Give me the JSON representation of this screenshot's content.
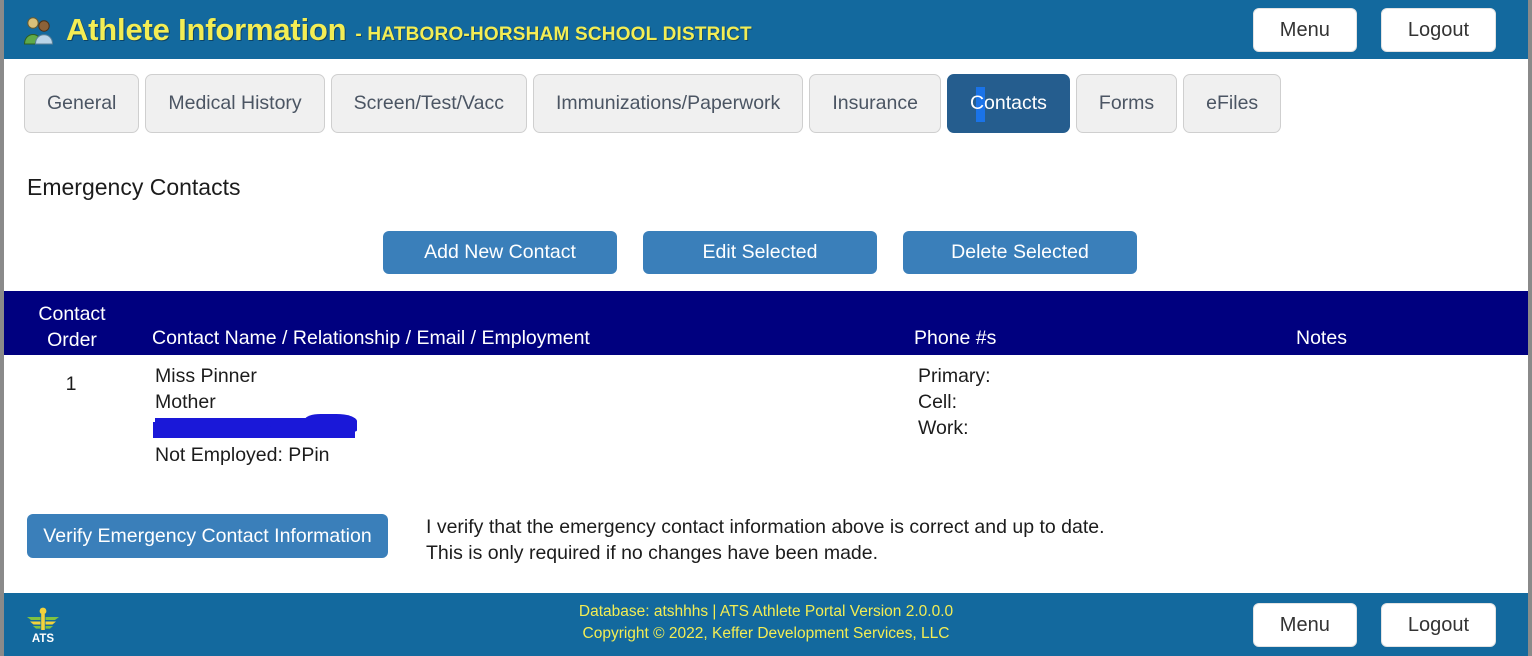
{
  "header": {
    "icon": "people-icon",
    "title": "Athlete Information",
    "subtitle": "- HATBORO-HORSHAM SCHOOL DISTRICT",
    "menu_label": "Menu",
    "logout_label": "Logout",
    "bg_color": "#13699e",
    "title_color": "#f3ed54"
  },
  "tabs": [
    {
      "label": "General",
      "active": false
    },
    {
      "label": "Medical History",
      "active": false
    },
    {
      "label": "Screen/Test/Vacc",
      "active": false
    },
    {
      "label": "Immunizations/Paperwork",
      "active": false
    },
    {
      "label": "Insurance",
      "active": false
    },
    {
      "label": "Contacts",
      "active": true
    },
    {
      "label": "Forms",
      "active": false
    },
    {
      "label": "eFiles",
      "active": false
    }
  ],
  "main": {
    "section_title": "Emergency Contacts",
    "actions": [
      {
        "label": "Add New Contact",
        "name": "add-new-contact-button"
      },
      {
        "label": "Edit Selected",
        "name": "edit-selected-button"
      },
      {
        "label": "Delete Selected",
        "name": "delete-selected-button"
      }
    ],
    "table": {
      "header_bg": "#00007f",
      "columns": {
        "order_line1": "Contact",
        "order_line2": "Order",
        "name": "Contact Name / Relationship / Email / Employment",
        "phone": "Phone #s",
        "notes": "Notes"
      },
      "rows": [
        {
          "order": "1",
          "name": "Miss Pinner",
          "relationship": "Mother",
          "email": "",
          "email_redacted": true,
          "redaction_color": "#1a18d8",
          "employment": "Not Employed: PPin",
          "phones": [
            {
              "label": "Primary:",
              "value": ""
            },
            {
              "label": "Cell:",
              "value": ""
            },
            {
              "label": "Work:",
              "value": ""
            }
          ],
          "notes": ""
        }
      ]
    },
    "verify": {
      "button_label": "Verify Emergency Contact Information",
      "line1": "I verify that the emergency contact information above is correct and up to date.",
      "line2": "This is only required if no changes have been made."
    }
  },
  "footer": {
    "logo": "ats-logo-icon",
    "line1": "Database: atshhhs | ATS Athlete Portal Version 2.0.0.0",
    "line2": "Copyright © 2022, Keffer Development Services, LLC",
    "menu_label": "Menu",
    "logout_label": "Logout",
    "bg_color": "#13699e",
    "text_color": "#f3ed54"
  }
}
